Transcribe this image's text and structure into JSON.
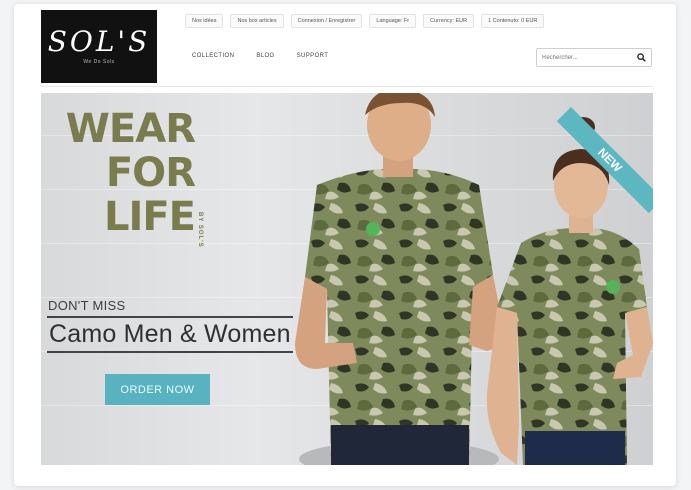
{
  "brand": {
    "logo_text": "SOL'S",
    "tagline": "We Do Sols"
  },
  "topbar": {
    "links": [
      "Nos idées",
      "Nos box articles",
      "Connexion / Enregistrer",
      "Language: Fr",
      "Currency: EUR",
      "1 Contenuto: 0 EUR"
    ]
  },
  "nav": {
    "items": [
      "COLLECTION",
      "BLOG",
      "SUPPORT"
    ]
  },
  "search": {
    "placeholder": "Rechercher..."
  },
  "banner": {
    "headline": [
      "WEAR",
      "FOR",
      "LIFE"
    ],
    "vertical_tag": "BY SOL'S",
    "dont_miss": "DON'T MISS",
    "product_title": "Camo Men & Women",
    "cta_label": "ORDER NOW",
    "ribbon": "NEW",
    "colors": {
      "headline": "#7b7c4d",
      "cta": "#58b2c0",
      "ribbon": "#5cb7c2"
    }
  }
}
